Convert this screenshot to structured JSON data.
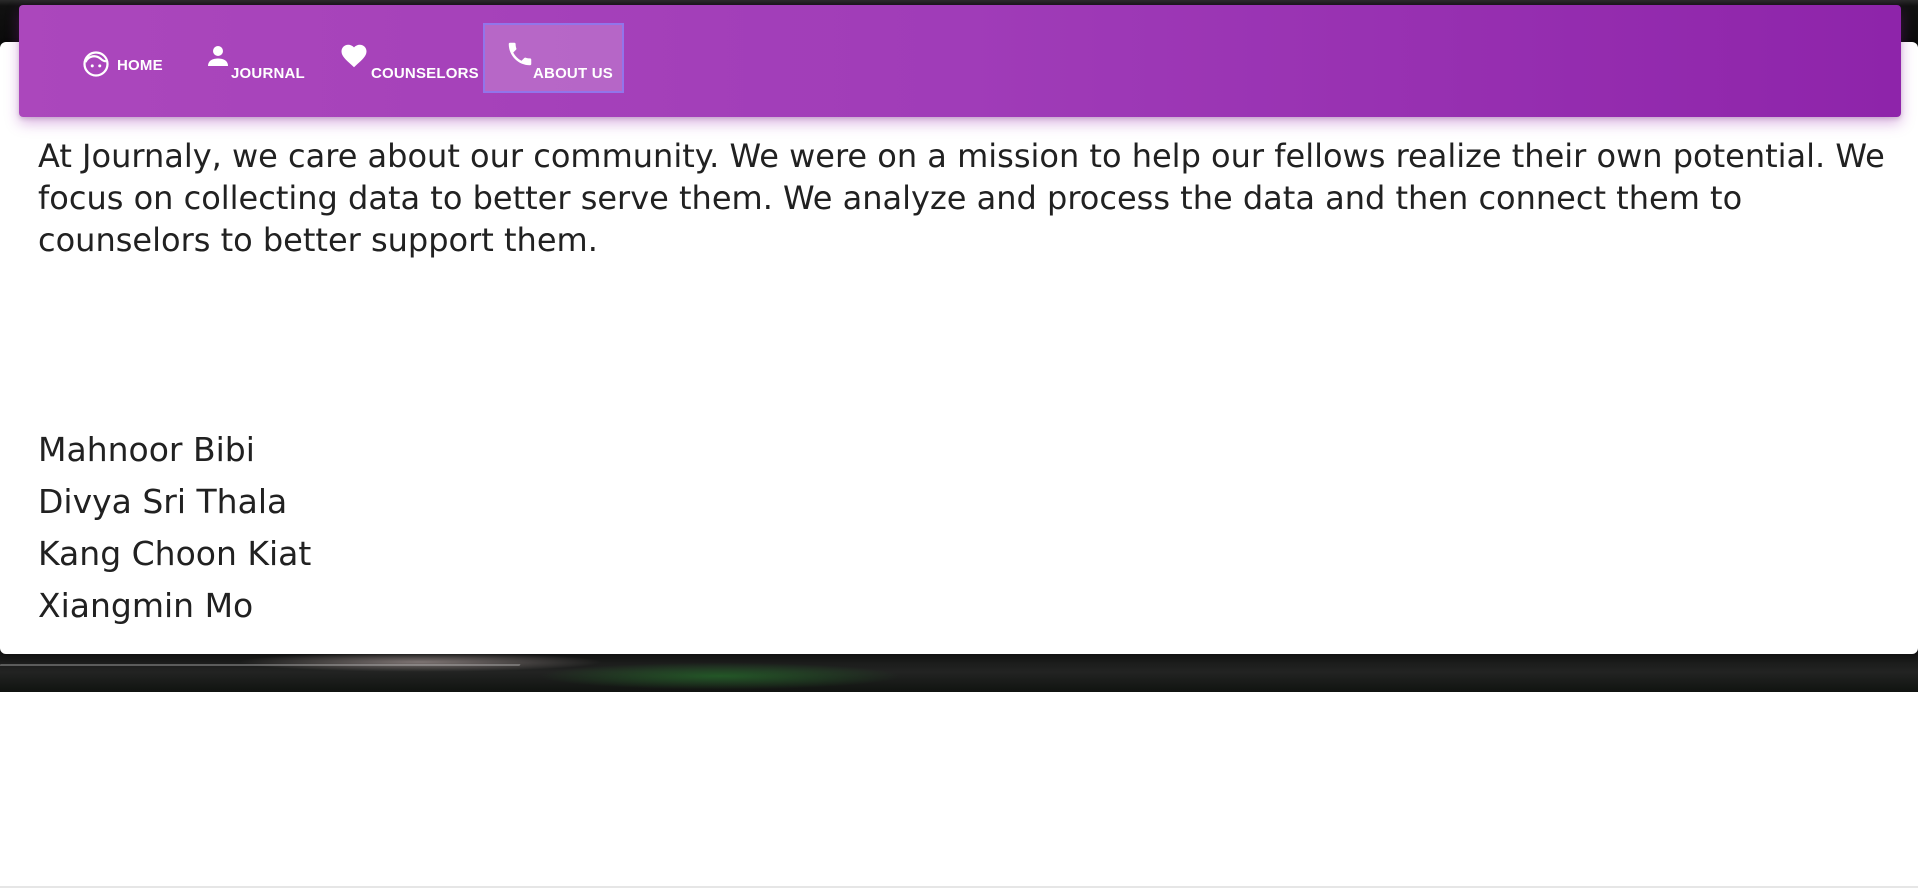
{
  "nav": {
    "items": [
      {
        "label": "HOME",
        "icon": "face-icon",
        "active": false
      },
      {
        "label": "JOURNAL",
        "icon": "person-icon",
        "active": false
      },
      {
        "label": "COUNSELORS",
        "icon": "heart-icon",
        "active": false
      },
      {
        "label": "ABOUT US",
        "icon": "phone-icon",
        "active": true
      }
    ],
    "colors": {
      "start": "#ab47bc",
      "end": "#8e24aa",
      "active_border": "#8c78f0"
    }
  },
  "about": {
    "text": "At Journaly, we care about our community. We were on a mission to help our fellows realize their own potential. We focus on collecting data to better serve them. We analyze and process the data and then connect them to counselors to better support them."
  },
  "team": {
    "members": [
      "Mahnoor Bibi",
      "Divya Sri Thala",
      "Kang Choon Kiat",
      "Xiangmin Mo"
    ]
  }
}
